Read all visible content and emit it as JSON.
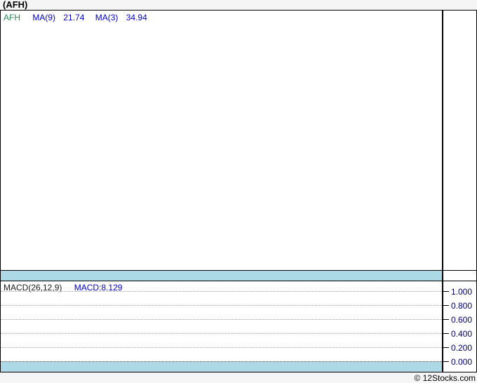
{
  "title": "(AFH)",
  "legend": {
    "symbol": "AFH",
    "ma9_label": "MA(9)",
    "ma9_value": "21.74",
    "ma3_label": "MA(3)",
    "ma3_value": "34.94"
  },
  "macd_panel": {
    "params_label": "MACD(26,12,9)",
    "value_label": "MACD:8.129"
  },
  "axis": {
    "ticks": [
      "1.000",
      "0.800",
      "0.600",
      "0.400",
      "0.200",
      "0.000"
    ]
  },
  "footer": {
    "credit": "© 12Stocks.com"
  },
  "colors": {
    "page_background": "#F5F5F5",
    "frame_border": "#000000",
    "band_light_blue": "#ADD8E6",
    "symbol_green": "#2E8B57",
    "indicator_blue": "#0000CC",
    "axis_label_navy": "#000066",
    "gridline_gray": "#9A9A9A"
  },
  "chart_data": {
    "type": "line",
    "title": "(AFH)",
    "legend_position": "top-left",
    "axis_side": "right",
    "panels": [
      {
        "name": "price",
        "legend": [
          "AFH",
          "MA(9) 21.74",
          "MA(3) 34.94"
        ],
        "indicators": {
          "MA(9)": 21.74,
          "MA(3)": 34.94
        },
        "series": []
      },
      {
        "name": "MACD(26,12,9)",
        "indicators": {
          "MACD": 8.129
        },
        "ylim": [
          0.0,
          1.0
        ],
        "yticks": [
          1.0,
          0.8,
          0.6,
          0.4,
          0.2,
          0.0
        ],
        "grid": "dotted",
        "series": []
      }
    ]
  }
}
